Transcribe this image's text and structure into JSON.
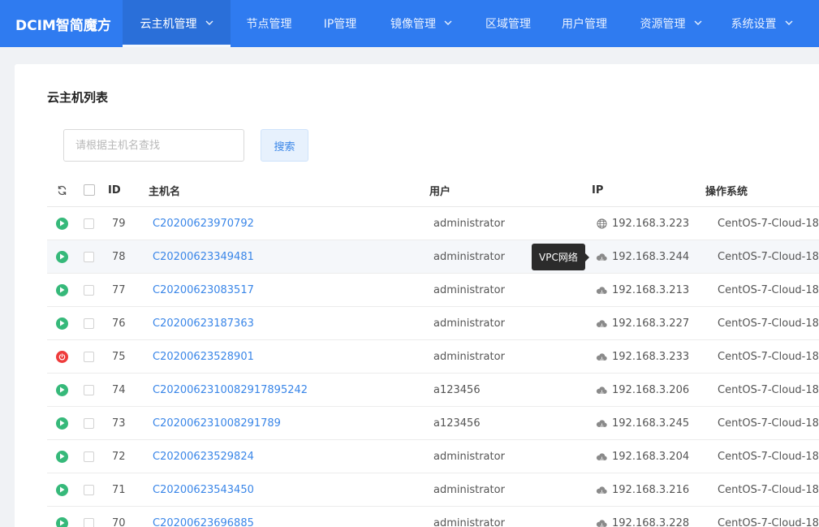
{
  "app": {
    "logo": "DCIM智简魔方"
  },
  "nav": {
    "items": [
      {
        "label": "云主机管理",
        "has_dropdown": true,
        "active": true
      },
      {
        "label": "节点管理",
        "has_dropdown": false
      },
      {
        "label": "IP管理",
        "has_dropdown": false
      },
      {
        "label": "镜像管理",
        "has_dropdown": true
      },
      {
        "label": "区域管理",
        "has_dropdown": false
      },
      {
        "label": "用户管理",
        "has_dropdown": false
      },
      {
        "label": "资源管理",
        "has_dropdown": true
      },
      {
        "label": "系统设置",
        "has_dropdown": true
      }
    ]
  },
  "page": {
    "title": "云主机列表"
  },
  "search": {
    "placeholder": "请根据主机名查找",
    "value": "",
    "button_label": "搜索"
  },
  "table": {
    "columns": {
      "id": "ID",
      "host": "主机名",
      "user": "用户",
      "ip": "IP",
      "os": "操作系统"
    },
    "rows": [
      {
        "status": "running",
        "id": "79",
        "host": "C20200623970792",
        "user": "administrator",
        "ip_type": "globe-icon",
        "ip": "192.168.3.223",
        "os": "CentOS-7-Cloud-18"
      },
      {
        "status": "running",
        "id": "78",
        "host": "C20200623349481",
        "user": "administrator",
        "ip_type": "cloud-icon",
        "ip": "192.168.3.244",
        "os": "CentOS-7-Cloud-18"
      },
      {
        "status": "running",
        "id": "77",
        "host": "C20200623083517",
        "user": "administrator",
        "ip_type": "cloud-icon",
        "ip": "192.168.3.213",
        "os": "CentOS-7-Cloud-18"
      },
      {
        "status": "running",
        "id": "76",
        "host": "C20200623187363",
        "user": "administrator",
        "ip_type": "cloud-icon",
        "ip": "192.168.3.227",
        "os": "CentOS-7-Cloud-18"
      },
      {
        "status": "stopped",
        "id": "75",
        "host": "C20200623528901",
        "user": "administrator",
        "ip_type": "cloud-icon",
        "ip": "192.168.3.233",
        "os": "CentOS-7-Cloud-18"
      },
      {
        "status": "running",
        "id": "74",
        "host": "C202006231008291789​5242",
        "user": "a123456",
        "ip_type": "cloud-icon",
        "ip": "192.168.3.206",
        "os": "CentOS-7-Cloud-18"
      },
      {
        "status": "running",
        "id": "73",
        "host": "C202006231008291789",
        "user": "a123456",
        "ip_type": "cloud-icon",
        "ip": "192.168.3.245",
        "os": "CentOS-7-Cloud-18"
      },
      {
        "status": "running",
        "id": "72",
        "host": "C20200623529824",
        "user": "administrator",
        "ip_type": "cloud-icon",
        "ip": "192.168.3.204",
        "os": "CentOS-7-Cloud-18"
      },
      {
        "status": "running",
        "id": "71",
        "host": "C20200623543450",
        "user": "administrator",
        "ip_type": "cloud-icon",
        "ip": "192.168.3.216",
        "os": "CentOS-7-Cloud-18"
      },
      {
        "status": "running",
        "id": "70",
        "host": "C20200623696885",
        "user": "administrator",
        "ip_type": "cloud-icon",
        "ip": "192.168.3.228",
        "os": "CentOS-7-Cloud-18"
      }
    ]
  },
  "tooltip": {
    "text": "VPC网络"
  },
  "colors": {
    "nav_bg": "#2f7bf0",
    "link": "#3a86e8",
    "running": "#36b97a",
    "stopped": "#ee3b3b"
  }
}
